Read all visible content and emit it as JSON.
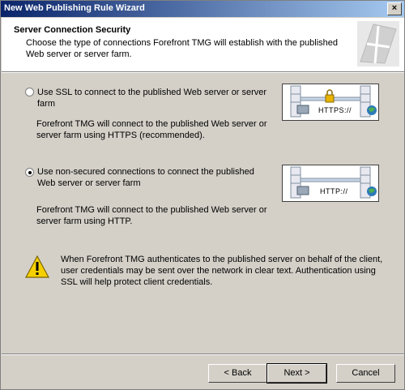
{
  "window": {
    "title": "New Web Publishing Rule Wizard",
    "close_glyph": "×"
  },
  "header": {
    "title": "Server Connection Security",
    "description": "Choose the type of connections Forefront TMG will establish with the published Web server or server farm."
  },
  "options": [
    {
      "label": "Use SSL to connect to the published Web server or server farm",
      "description": "Forefront TMG will connect to the published Web server or server farm using HTTPS (recommended).",
      "selected": false,
      "diagram_protocol": "HTTPS://"
    },
    {
      "label": "Use non-secured connections to connect the published Web server or server farm",
      "description": "Forefront TMG will connect to the published Web server or server farm using HTTP.",
      "selected": true,
      "diagram_protocol": "HTTP://"
    }
  ],
  "warning": {
    "icon": "warning-icon",
    "text": "When Forefront TMG authenticates to the published server on behalf of the client, user credentials may be sent over the network in clear text. Authentication using SSL will help protect client credentials."
  },
  "buttons": {
    "back": "< Back",
    "next": "Next >",
    "cancel": "Cancel"
  }
}
